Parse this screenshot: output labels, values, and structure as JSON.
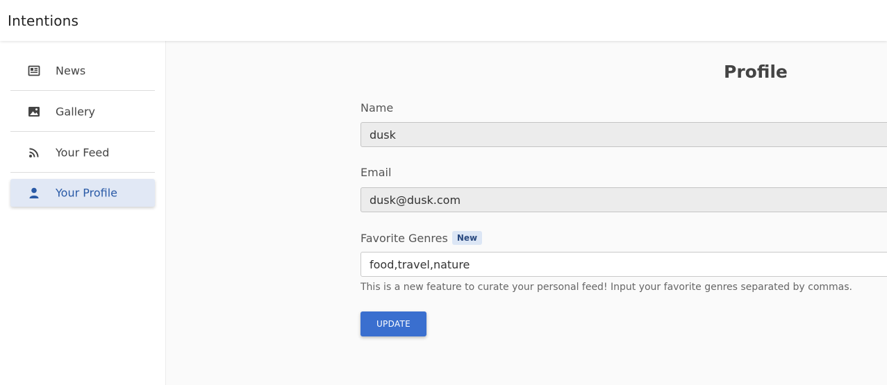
{
  "app": {
    "title": "Intentions"
  },
  "sidebar": {
    "items": [
      {
        "label": "News",
        "icon": "newspaper-icon",
        "active": false
      },
      {
        "label": "Gallery",
        "icon": "image-icon",
        "active": false
      },
      {
        "label": "Your Feed",
        "icon": "rss-icon",
        "active": false
      },
      {
        "label": "Your Profile",
        "icon": "user-icon",
        "active": true
      }
    ]
  },
  "profile": {
    "title": "Profile",
    "name_label": "Name",
    "name_value": "dusk",
    "email_label": "Email",
    "email_value": "dusk@dusk.com",
    "genres_label": "Favorite Genres",
    "genres_badge": "New",
    "genres_value": "food,travel,nature",
    "genres_help": "This is a new feature to curate your personal feed! Input your favorite genres separated by commas.",
    "update_label": "UPDATE"
  },
  "colors": {
    "accent": "#3a6fcf",
    "active_nav_bg": "#e1e8f5",
    "active_nav_text": "#2a5aa6",
    "badge_bg": "#dce6f5"
  }
}
